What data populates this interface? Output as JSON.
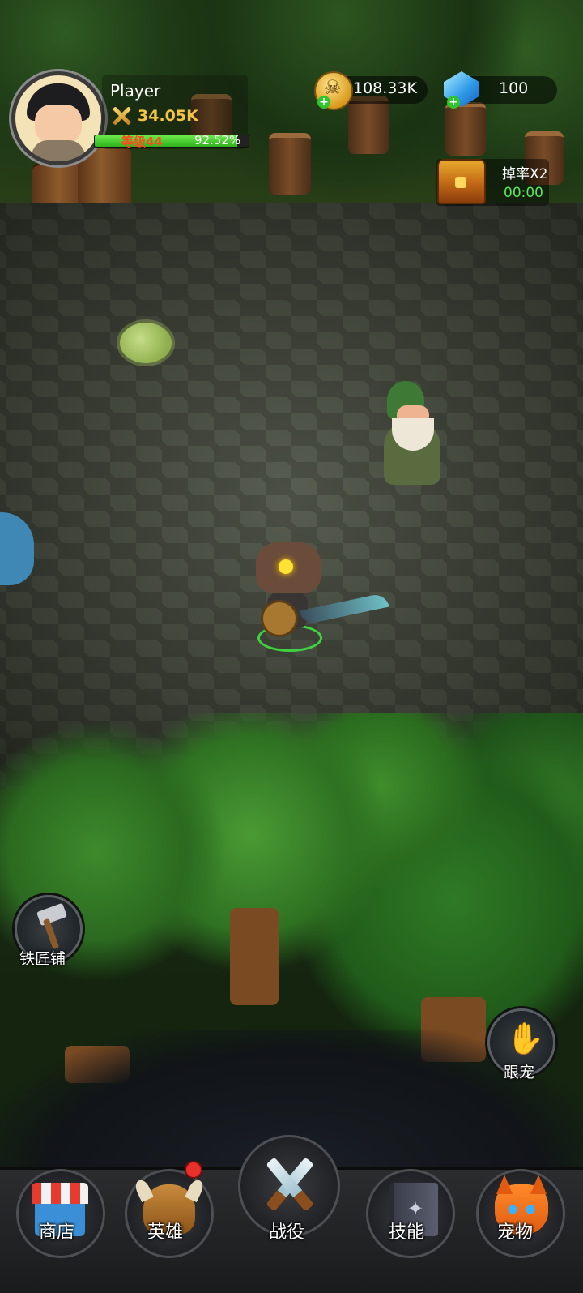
{
  "player": {
    "name": "Player",
    "power": "34.05K",
    "level_label": "等级44",
    "exp_percent": "92.52%",
    "exp_fraction": 0.9252
  },
  "resources": {
    "gold": "108.33K",
    "gems": "100"
  },
  "drop_bonus": {
    "label": "掉率X2",
    "timer": "00:00"
  },
  "side_buttons": {
    "blacksmith": "铁匠铺",
    "follow_pet": "跟宠"
  },
  "nav": {
    "shop": "商店",
    "heroes": "英雄",
    "campaign": "战役",
    "skills": "技能",
    "pets": "宠物"
  },
  "colors": {
    "exp_bar": "#2fb21d",
    "level_text": "#ff4b1f",
    "power_text": "#f5c542",
    "timer_text": "#5ee65e",
    "hero_ring": "#3fd13f"
  },
  "icons": {
    "power": "crossed-swords-icon",
    "gold": "skull-coin-icon",
    "gems": "blue-gem-icon",
    "drop": "treasure-chest-icon",
    "blacksmith": "hammer-icon",
    "follow_pet": "hand-icon",
    "shop": "shop-stall-icon",
    "heroes": "viking-helmet-icon",
    "campaign": "crossed-swords-icon",
    "skills": "spellbook-icon",
    "pets": "fox-icon"
  }
}
